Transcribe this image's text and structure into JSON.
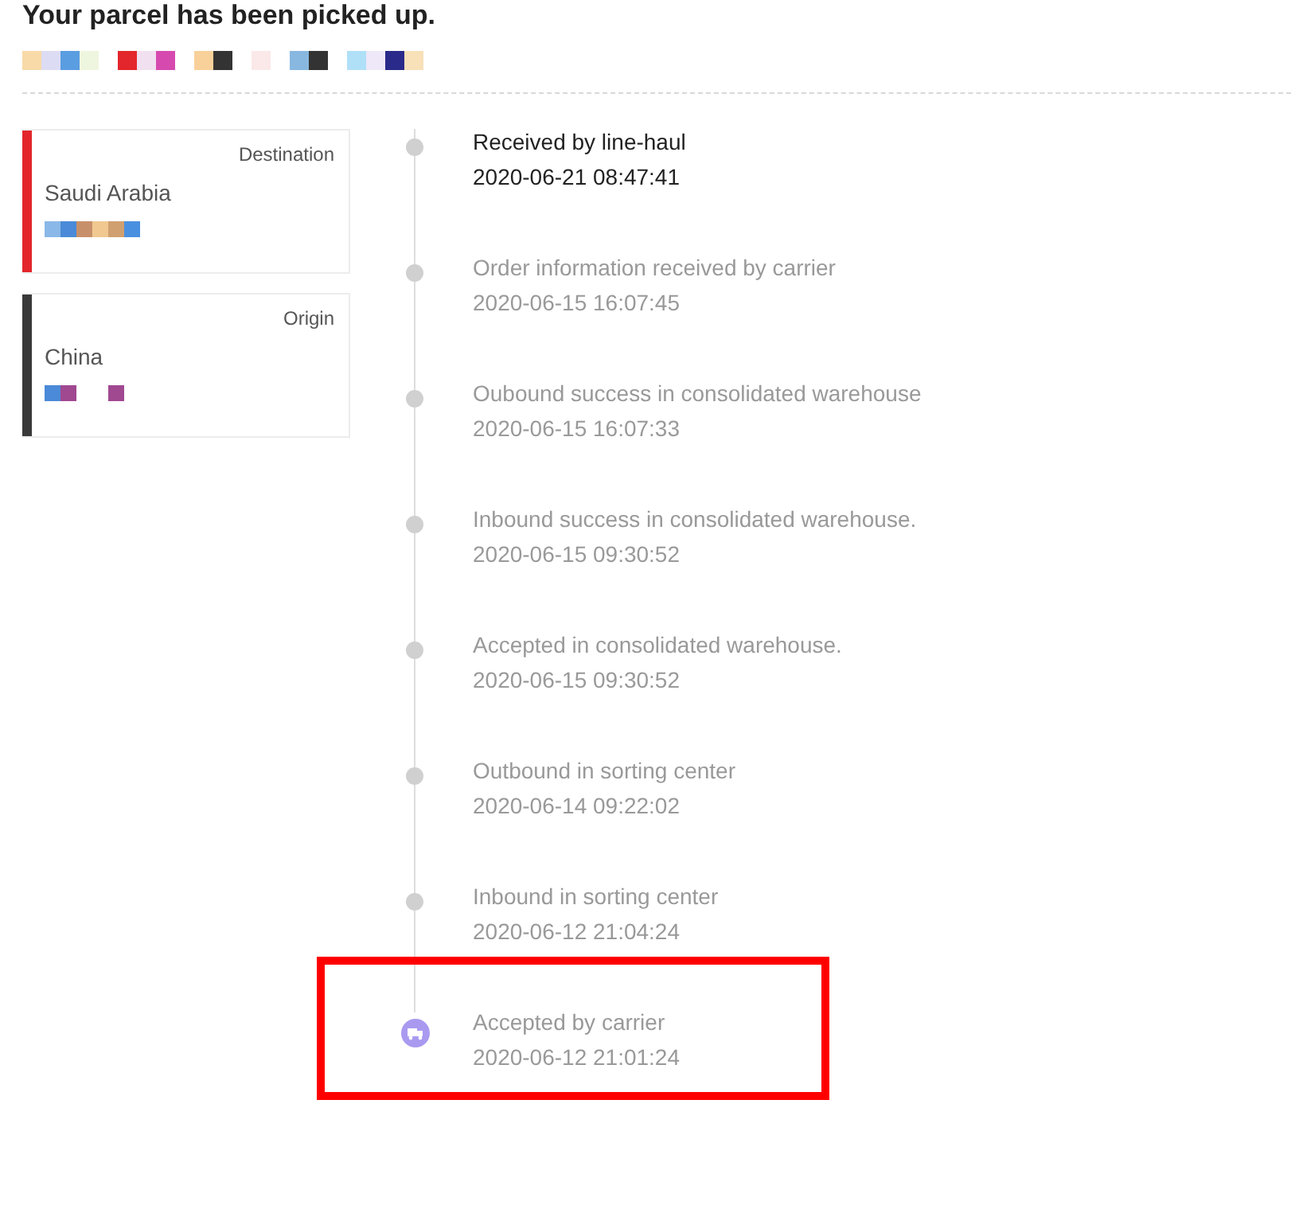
{
  "header": {
    "title": "Your parcel has been picked up."
  },
  "places": [
    {
      "role": "Destination",
      "country": "Saudi Arabia",
      "color": "#e3262b"
    },
    {
      "role": "Origin",
      "country": "China",
      "color": "#3a3a3a"
    }
  ],
  "events": [
    {
      "label": "Received by line-haul",
      "time": "2020-06-21 08:47:41",
      "current": true,
      "kind": "dot",
      "highlighted": false
    },
    {
      "label": "Order information received by carrier",
      "time": "2020-06-15 16:07:45",
      "current": false,
      "kind": "dot",
      "highlighted": false
    },
    {
      "label": "Oubound success in consolidated warehouse",
      "time": "2020-06-15 16:07:33",
      "current": false,
      "kind": "dot",
      "highlighted": false
    },
    {
      "label": "Inbound success in consolidated warehouse.",
      "time": "2020-06-15 09:30:52",
      "current": false,
      "kind": "dot",
      "highlighted": false
    },
    {
      "label": "Accepted in consolidated warehouse.",
      "time": "2020-06-15 09:30:52",
      "current": false,
      "kind": "dot",
      "highlighted": false
    },
    {
      "label": "Outbound in sorting center",
      "time": "2020-06-14 09:22:02",
      "current": false,
      "kind": "dot",
      "highlighted": false
    },
    {
      "label": "Inbound in sorting center",
      "time": "2020-06-12 21:04:24",
      "current": false,
      "kind": "dot",
      "highlighted": false
    },
    {
      "label": "Accepted by carrier",
      "time": "2020-06-12 21:01:24",
      "current": false,
      "kind": "truck",
      "highlighted": true
    }
  ]
}
